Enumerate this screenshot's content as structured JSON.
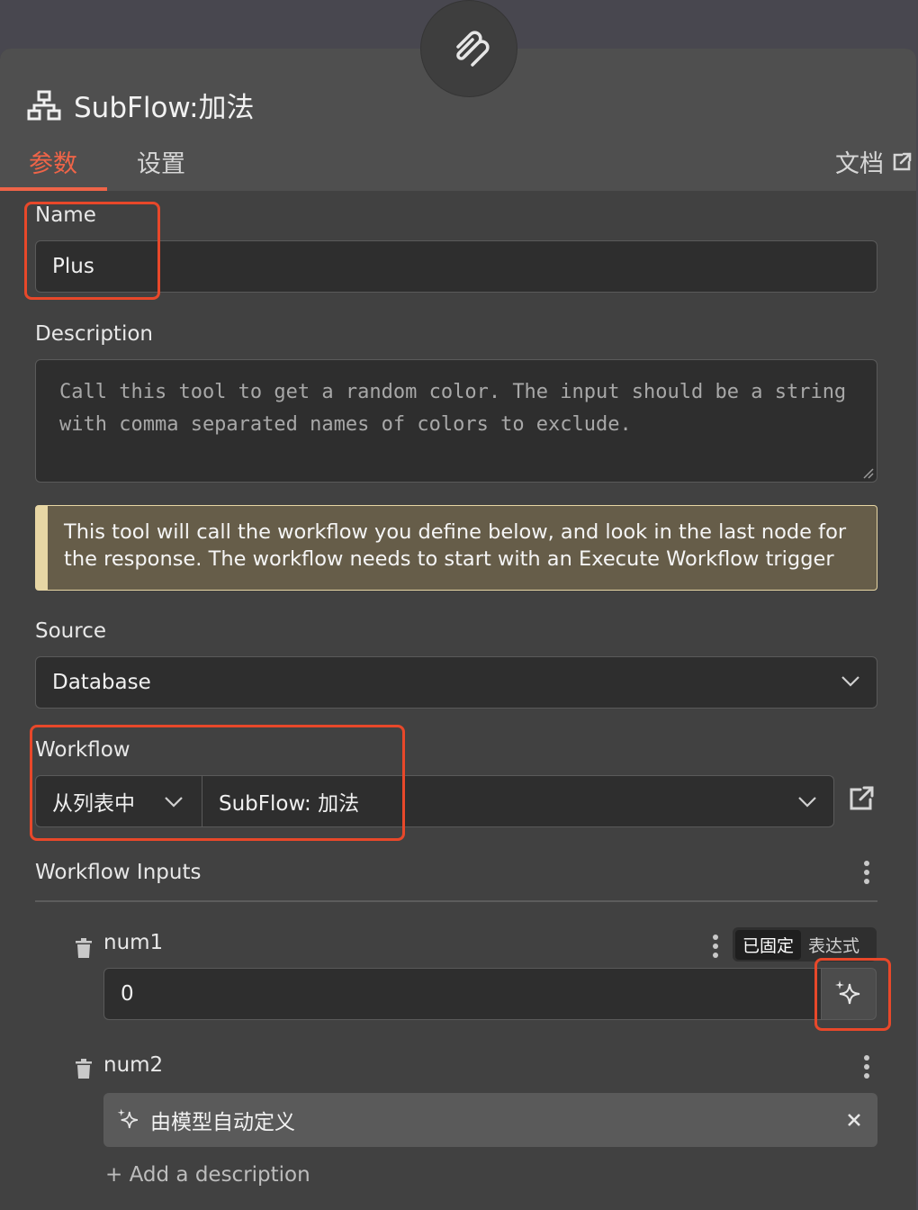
{
  "header": {
    "title": "SubFlow:加法",
    "node_icon": "sitemap-icon",
    "top_icon": "paperclip-icon"
  },
  "tabs": {
    "params": "参数",
    "settings": "设置",
    "docs": "文档"
  },
  "name_field": {
    "label": "Name",
    "value": "Plus"
  },
  "description": {
    "label": "Description",
    "placeholder": "Call this tool to get a random color. The input should be a string with comma separated names of colors to exclude."
  },
  "notice": {
    "text": "This tool will call the workflow you define below, and look in the last node for the response. The workflow needs to start with an Execute Workflow trigger"
  },
  "source": {
    "label": "Source",
    "value": "Database"
  },
  "workflow": {
    "label": "Workflow",
    "mode": "从列表中",
    "value": "SubFlow: 加法"
  },
  "workflow_inputs": {
    "label": "Workflow Inputs",
    "num1": {
      "label": "num1",
      "value": "0",
      "toggle_fixed": "已固定",
      "toggle_expr": "表达式"
    },
    "num2": {
      "label": "num2",
      "auto_text": "由模型自动定义"
    },
    "add_description": "+ Add a description"
  },
  "colors": {
    "accent": "#ef6448",
    "highlight": "#e8482a",
    "notice_border": "#e7d6a4"
  }
}
